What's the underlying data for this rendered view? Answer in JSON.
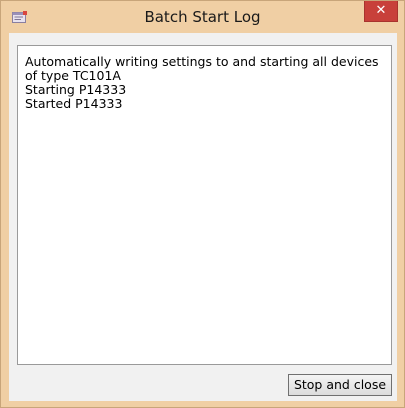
{
  "window": {
    "title": "Batch Start Log",
    "app_icon": "log-window-icon",
    "close_glyph": "✕",
    "colors": {
      "frame": "#f0cfa4",
      "close_button": "#c8403a",
      "client": "#f1f1f1"
    }
  },
  "log": {
    "lines": [
      "Automatically writing settings to and starting all devices of type TC101A",
      "Starting P14333",
      "Started P14333"
    ]
  },
  "footer": {
    "stop_label": "Stop and close"
  }
}
